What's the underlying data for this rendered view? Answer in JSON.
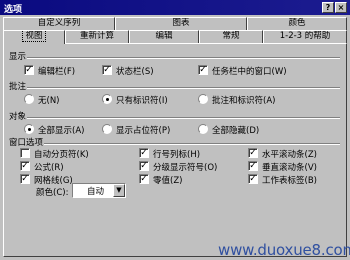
{
  "window": {
    "title": "选项",
    "help_btn": "?",
    "close_btn": "×"
  },
  "tabs": {
    "back": [
      "自定义序列",
      "图表",
      "颜色"
    ],
    "front": [
      "视图",
      "重新计算",
      "编辑",
      "常规",
      "1-2-3 的帮助"
    ],
    "selected": "视图"
  },
  "show": {
    "title": "显示",
    "items": [
      {
        "label": "编辑栏(F)",
        "checked": true
      },
      {
        "label": "状态栏(S)",
        "checked": true
      },
      {
        "label": "任务栏中的窗口(W)",
        "checked": true
      }
    ]
  },
  "comments": {
    "title": "批注",
    "options": [
      {
        "label": "无(N)",
        "selected": false
      },
      {
        "label": "只有标识符(I)",
        "selected": true
      },
      {
        "label": "批注和标识符(A)",
        "selected": false
      }
    ]
  },
  "objects": {
    "title": "对象",
    "options": [
      {
        "label": "全部显示(A)",
        "selected": true
      },
      {
        "label": "显示占位符(P)",
        "selected": false
      },
      {
        "label": "全部隐藏(D)",
        "selected": false
      }
    ]
  },
  "window_options": {
    "title": "窗口选项",
    "col1": [
      {
        "label": "自动分页符(K)",
        "checked": false
      },
      {
        "label": "公式(R)",
        "checked": true
      },
      {
        "label": "网格线(G)",
        "checked": true
      }
    ],
    "col2": [
      {
        "label": "行号列标(H)",
        "checked": true
      },
      {
        "label": "分级显示符号(O)",
        "checked": true
      },
      {
        "label": "零值(Z)",
        "checked": true
      }
    ],
    "col3": [
      {
        "label": "水平滚动条(Z)",
        "checked": true
      },
      {
        "label": "垂直滚动条(V)",
        "checked": true
      },
      {
        "label": "工作表标签(B)",
        "checked": true
      }
    ],
    "color_label": "颜色(C):",
    "color_value": "自动"
  },
  "watermark": "www.duoxue8.com"
}
